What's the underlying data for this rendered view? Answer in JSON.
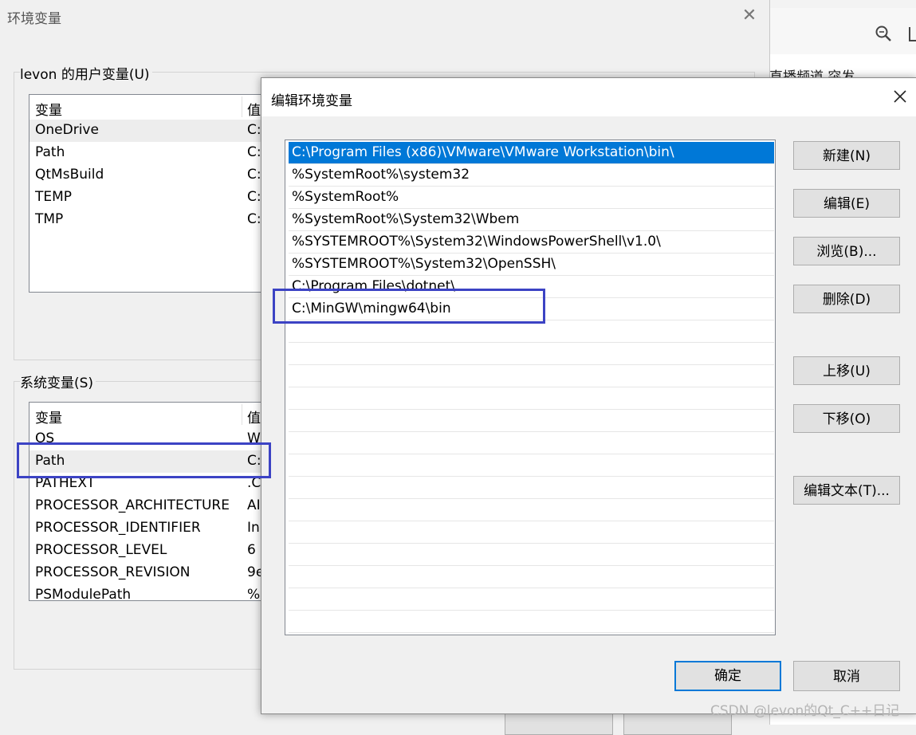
{
  "background_browser": {
    "headline": "直播频道 突发..."
  },
  "env_dialog": {
    "title": "环境变量",
    "user_section": {
      "label": "levon 的用户变量(U)",
      "columns": [
        "变量",
        "值"
      ],
      "rows": [
        {
          "name": "OneDrive",
          "value": "C:"
        },
        {
          "name": "Path",
          "value": "C:"
        },
        {
          "name": "QtMsBuild",
          "value": "C:"
        },
        {
          "name": "TEMP",
          "value": "C:"
        },
        {
          "name": "TMP",
          "value": "C:"
        }
      ]
    },
    "system_section": {
      "label": "系统变量(S)",
      "columns": [
        "变量",
        "值"
      ],
      "rows": [
        {
          "name": "OS",
          "value": "W"
        },
        {
          "name": "Path",
          "value": "C:"
        },
        {
          "name": "PATHEXT",
          "value": ".C"
        },
        {
          "name": "PROCESSOR_ARCHITECTURE",
          "value": "AI"
        },
        {
          "name": "PROCESSOR_IDENTIFIER",
          "value": "In"
        },
        {
          "name": "PROCESSOR_LEVEL",
          "value": "6"
        },
        {
          "name": "PROCESSOR_REVISION",
          "value": "9e"
        },
        {
          "name": "PSModulePath",
          "value": "%"
        }
      ]
    }
  },
  "edit_dialog": {
    "title": "编辑环境变量",
    "paths": [
      "C:\\Program Files (x86)\\VMware\\VMware Workstation\\bin\\",
      "%SystemRoot%\\system32",
      "%SystemRoot%",
      "%SystemRoot%\\System32\\Wbem",
      "%SYSTEMROOT%\\System32\\WindowsPowerShell\\v1.0\\",
      "%SYSTEMROOT%\\System32\\OpenSSH\\",
      "C:\\Program Files\\dotnet\\",
      "C:\\MinGW\\mingw64\\bin"
    ],
    "buttons": {
      "new": "新建(N)",
      "edit": "编辑(E)",
      "browse": "浏览(B)...",
      "delete": "删除(D)",
      "move_up": "上移(U)",
      "move_down": "下移(O)",
      "edit_text": "编辑文本(T)...",
      "ok": "确定",
      "cancel": "取消"
    }
  },
  "watermark": "CSDN @levon的Qt_C++日记"
}
